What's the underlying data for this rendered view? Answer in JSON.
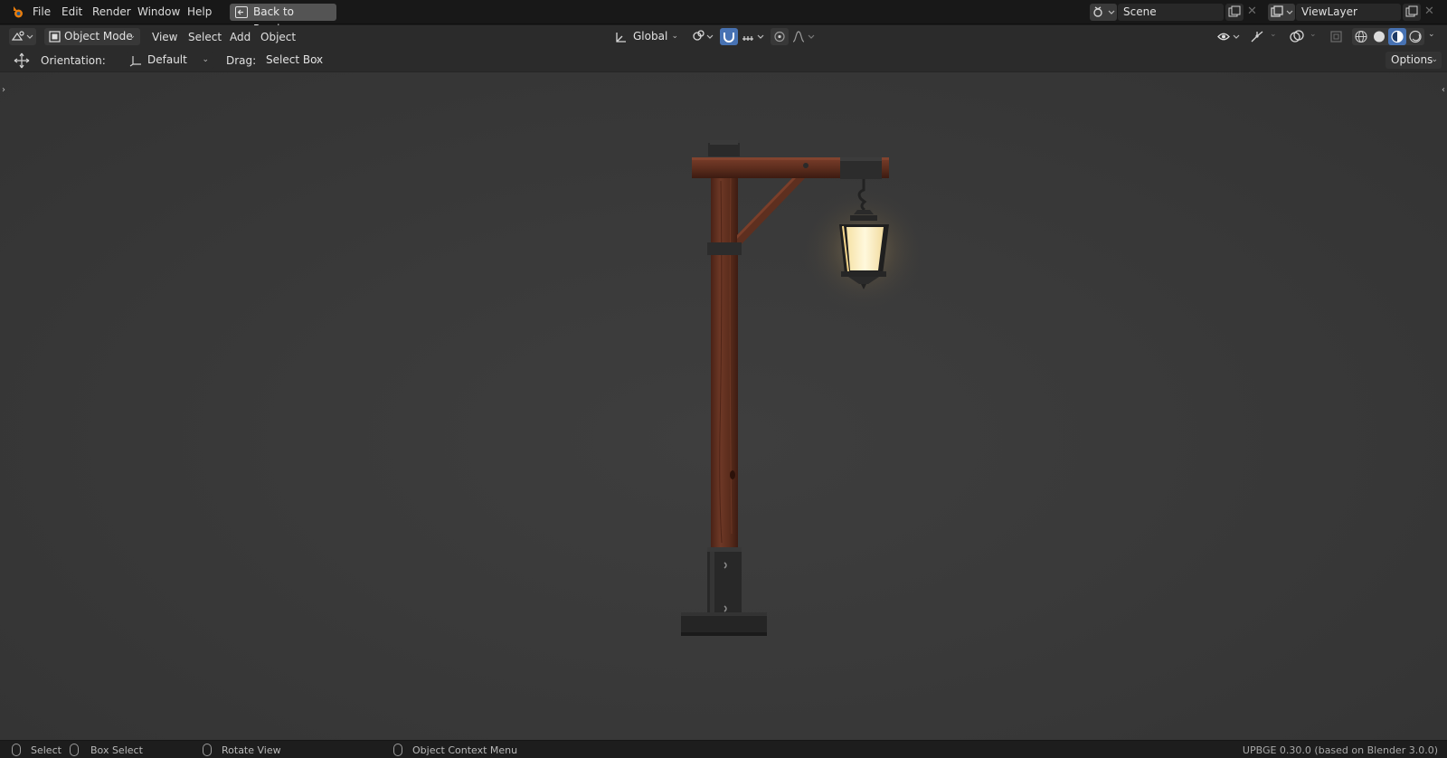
{
  "topbar": {
    "menus": [
      "File",
      "Edit",
      "Render",
      "Window",
      "Help"
    ],
    "back_button": "Back to Previous",
    "scene_name": "Scene",
    "view_layer": "ViewLayer"
  },
  "header": {
    "editor_icon": "viewport-icon",
    "mode": "Object Mode",
    "menus": [
      "View",
      "Select",
      "Add",
      "Object"
    ],
    "transform_orientation": "Global"
  },
  "toolbar": {
    "orientation_label": "Orientation:",
    "orientation_value": "Default",
    "drag_label": "Drag:",
    "drag_value": "Select Box",
    "options_label": "Options"
  },
  "statusbar": {
    "select": "Select",
    "box_select": "Box Select",
    "rotate_view": "Rotate View",
    "context_menu": "Object Context Menu",
    "version": "UPBGE 0.30.0 (based on Blender 3.0.0)"
  },
  "colors": {
    "accent": "#4772b3",
    "lantern_glow": "#fff3c8",
    "wood": "#6b3322"
  }
}
